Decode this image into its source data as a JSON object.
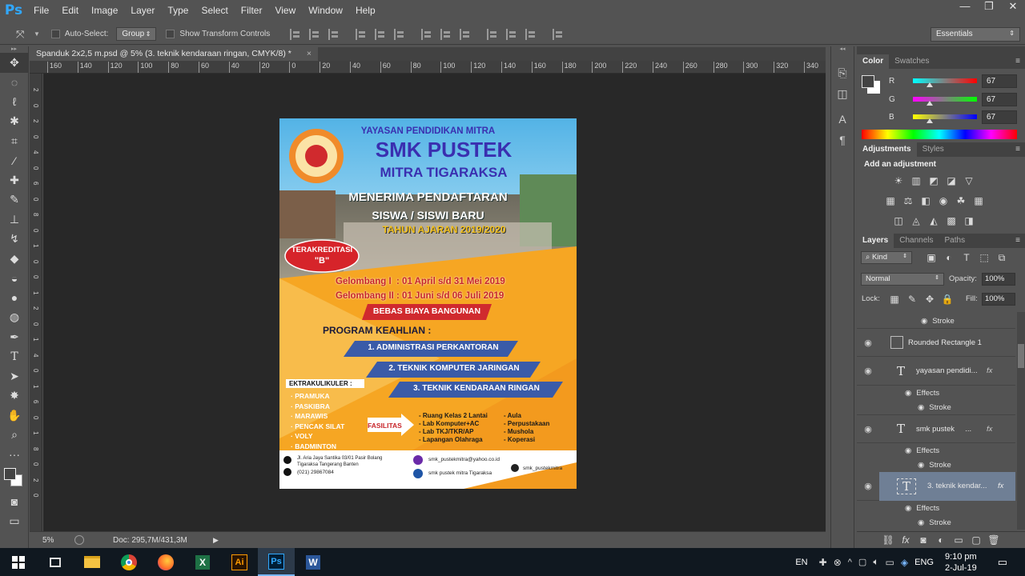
{
  "app": {
    "logo": "Ps"
  },
  "menu": [
    "File",
    "Edit",
    "Image",
    "Layer",
    "Type",
    "Select",
    "Filter",
    "View",
    "Window",
    "Help"
  ],
  "window_controls": [
    "—",
    "❐",
    "✕"
  ],
  "options_bar": {
    "auto_select_label": "Auto-Select:",
    "auto_select_value": "Group",
    "transform_label": "Show Transform Controls",
    "workspace": "Essentials"
  },
  "document": {
    "tab_title": "Spanduk 2x2,5 m.psd @ 5% (3. teknik kendaraan ringan, CMYK/8) *",
    "close": "×",
    "ruler_h_ticks": [
      "160",
      "140",
      "120",
      "100",
      "80",
      "60",
      "40",
      "20",
      "0",
      "20",
      "40",
      "60",
      "80",
      "100",
      "120",
      "140",
      "160",
      "180",
      "200",
      "220",
      "240",
      "260",
      "280",
      "300",
      "320",
      "340"
    ],
    "ruler_v_ticks": [
      "2",
      "0",
      "2",
      "0",
      "4",
      "0",
      "6",
      "0",
      "8",
      "0",
      "1",
      "0",
      "0",
      "1",
      "2",
      "0",
      "1",
      "4",
      "0",
      "1",
      "6",
      "0",
      "1",
      "8",
      "0",
      "2",
      "0"
    ]
  },
  "status": {
    "zoom": "5%",
    "doc_size": "Doc: 295,7M/431,3M"
  },
  "poster": {
    "yayasan": "YAYASAN PENDIDIKAN MITRA",
    "school": "SMK PUSTEK",
    "subtitle": "MITRA TIGARAKSA",
    "line1": "MENERIMA PENDAFTARAN",
    "line2": "SISWA / SISWI BARU",
    "line3": "TAHUN AJARAN 2019/2020",
    "badge1": "TERAKREDITASI",
    "badge2": "\"B\"",
    "gel1": "Gelombang I  : 01 April s/d 31 Mei 2019",
    "gel2": "Gelombang II : 01 Juni s/d 06 Juli 2019",
    "banner": "BEBAS BIAYA BANGUNAN",
    "program_title": "PROGRAM KEAHLIAN :",
    "programs": [
      "1. ADMINISTRASI PERKANTORAN",
      "2. TEKNIK KOMPUTER JARINGAN",
      "3. TEKNIK KENDARAAN RINGAN"
    ],
    "ekstra_title": "EKTRAKULIKULER :",
    "ekstra": [
      "· PRAMUKA",
      "· PASKIBRA",
      "· MARAWIS",
      "· PENCAK SILAT",
      "· VOLY",
      "· BADMINTON"
    ],
    "fasilitas_label": "FASILITAS",
    "fasilitas_left": [
      "- Ruang Kelas 2 Lantai",
      "- Lab Komputer+AC",
      "- Lab TKJ/TKR/AP",
      "- Lapangan Olahraga"
    ],
    "fasilitas_right": [
      "- Aula",
      "- Perpustakaan",
      "- Mushola",
      "- Koperasi"
    ],
    "address1": "Jl. Aria Jaya Santika 03/01 Pasir Bolang",
    "address2": "Tigaraksa Tangerang Banten",
    "phone": "(021) 29867084",
    "email": "smk_pustekmitra@yahoo.co.id",
    "facebook": "smk pustek mitra Tigaraksa",
    "instagram": "smk_pustekmitra"
  },
  "color_panel": {
    "tabs": [
      "Color",
      "Swatches"
    ],
    "r_label": "R",
    "g_label": "G",
    "b_label": "B",
    "r": "67",
    "g": "67",
    "b": "67",
    "fg_color": "#434343"
  },
  "adjustments": {
    "tabs": [
      "Adjustments",
      "Styles"
    ],
    "heading": "Add an adjustment"
  },
  "layers": {
    "tabs": [
      "Layers",
      "Channels",
      "Paths"
    ],
    "filter_kind": "Kind",
    "blend_mode": "Normal",
    "opacity_label": "Opacity:",
    "opacity": "100%",
    "lock_label": "Lock:",
    "fill_label": "Fill:",
    "fill": "100%",
    "rows": [
      {
        "kind": "stroke",
        "name": "Stroke"
      },
      {
        "kind": "shape",
        "name": "Rounded Rectangle 1"
      },
      {
        "kind": "text",
        "name": "yayasan pendidi...",
        "fx": "fx"
      },
      {
        "kind": "effects",
        "name": "Effects"
      },
      {
        "kind": "stroke",
        "name": "Stroke"
      },
      {
        "kind": "text",
        "name": "smk pustek     ...",
        "fx": "fx"
      },
      {
        "kind": "effects",
        "name": "Effects"
      },
      {
        "kind": "stroke",
        "name": "Stroke"
      },
      {
        "kind": "text",
        "name": "3. teknik kendar...",
        "fx": "fx",
        "selected": true
      },
      {
        "kind": "effects",
        "name": "Effects"
      },
      {
        "kind": "stroke",
        "name": "Stroke"
      }
    ]
  },
  "taskbar": {
    "lang_top": "EN",
    "lang": "ENG",
    "time": "9:10 pm",
    "date": "2-Jul-19"
  }
}
